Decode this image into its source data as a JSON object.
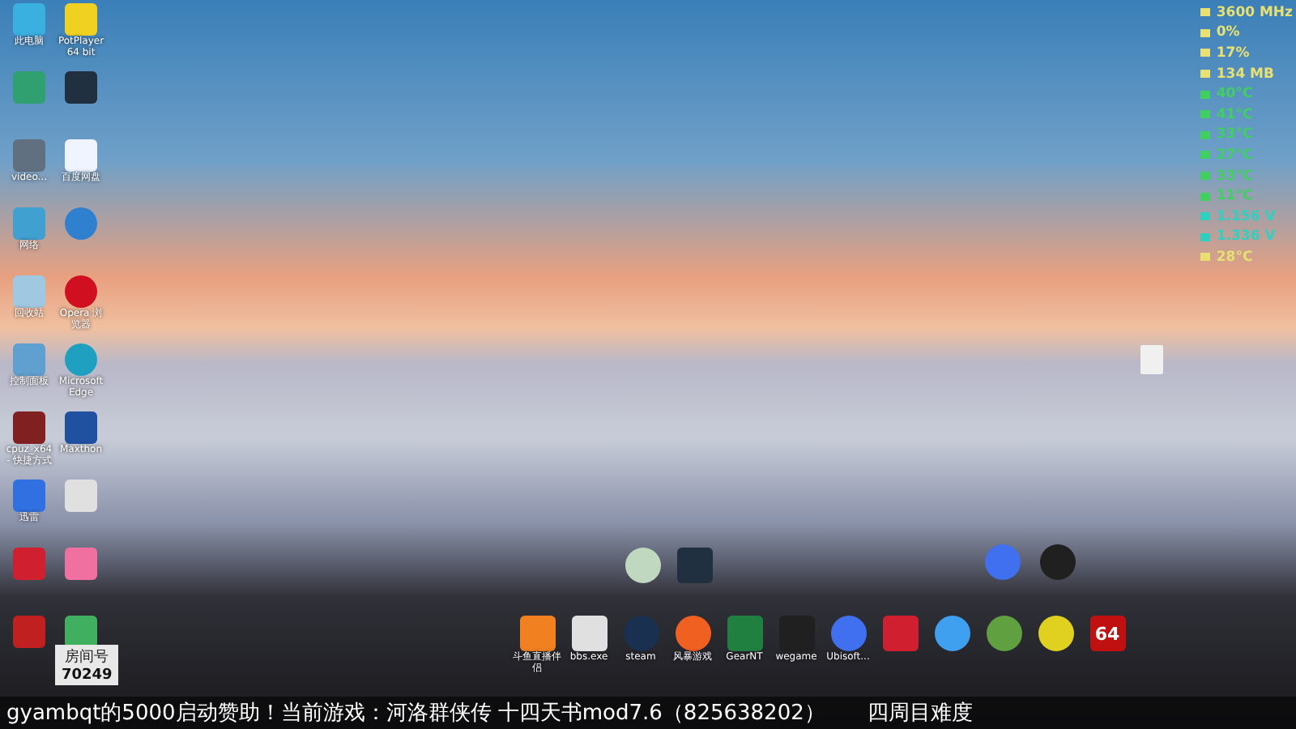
{
  "desktop_icons": [
    {
      "kind": "monitor",
      "label": "此电脑"
    },
    {
      "kind": "player",
      "label": "PotPlayer 64 bit"
    },
    {
      "kind": "shield"
    },
    {
      "kind": "game"
    },
    {
      "kind": "video",
      "label": "video..."
    },
    {
      "kind": "cloud",
      "label": "百度网盘"
    },
    {
      "kind": "network",
      "label": "网络"
    },
    {
      "kind": "globe"
    },
    {
      "kind": "bin",
      "label": "回收站"
    },
    {
      "kind": "opera",
      "label": "Opera 浏览器"
    },
    {
      "kind": "panel",
      "label": "控制面板"
    },
    {
      "kind": "edge",
      "label": "Microsoft Edge"
    },
    {
      "kind": "chip",
      "label": "cpuz_x64 - 快捷方式"
    },
    {
      "kind": "maxthon",
      "label": "Maxthon"
    },
    {
      "kind": "bird",
      "label": "迅雷"
    },
    {
      "kind": "help"
    },
    {
      "kind": "gplat"
    },
    {
      "kind": "pink"
    },
    {
      "kind": "red"
    },
    {
      "kind": "sheet"
    }
  ],
  "middle_icons": [
    {
      "kind": "orb"
    },
    {
      "kind": "game"
    }
  ],
  "right_icons": [
    {
      "kind": "swirl"
    },
    {
      "kind": "penguin"
    }
  ],
  "file_icon": {
    "kind": "doc"
  },
  "dock_icons": [
    {
      "kind": "fish",
      "label": "斗鱼直播伴侣"
    },
    {
      "kind": "grid",
      "label": "bbs.exe"
    },
    {
      "kind": "steam",
      "label": "steam"
    },
    {
      "kind": "fire",
      "label": "风暴游戏"
    },
    {
      "kind": "gear",
      "label": "GearNT"
    },
    {
      "kind": "wegame",
      "label": "wegame"
    },
    {
      "kind": "swirl",
      "label": "Ubisoft..."
    },
    {
      "kind": "gplat"
    },
    {
      "kind": "ring"
    },
    {
      "kind": "green"
    },
    {
      "kind": "music"
    },
    {
      "kind": "badge",
      "glyph": "64"
    }
  ],
  "sensors": [
    {
      "value": "3600 MHz",
      "color": "#e8e070"
    },
    {
      "value": "0%",
      "color": "#e8e070"
    },
    {
      "value": "17%",
      "color": "#e8e070"
    },
    {
      "value": "134 MB",
      "color": "#e8e070"
    },
    {
      "value": "40°C",
      "color": "#40d060"
    },
    {
      "value": "41°C",
      "color": "#40d060"
    },
    {
      "value": "33°C",
      "color": "#40d060"
    },
    {
      "value": "27°C",
      "color": "#40d060"
    },
    {
      "value": "33°C",
      "color": "#40d060"
    },
    {
      "value": "11°C",
      "color": "#40d060"
    },
    {
      "value": "1.156 V",
      "color": "#30d0c0"
    },
    {
      "value": "1.336 V",
      "color": "#30d0c0"
    },
    {
      "value": "28°C",
      "color": "#e8e070"
    }
  ],
  "room": {
    "label": "房间号",
    "number": "70249"
  },
  "ticker": [
    "gyambqt的5000启动赞助！当前游戏：河洛群侠传 十四天书mod7.6（825638202）",
    "四周目难度"
  ]
}
